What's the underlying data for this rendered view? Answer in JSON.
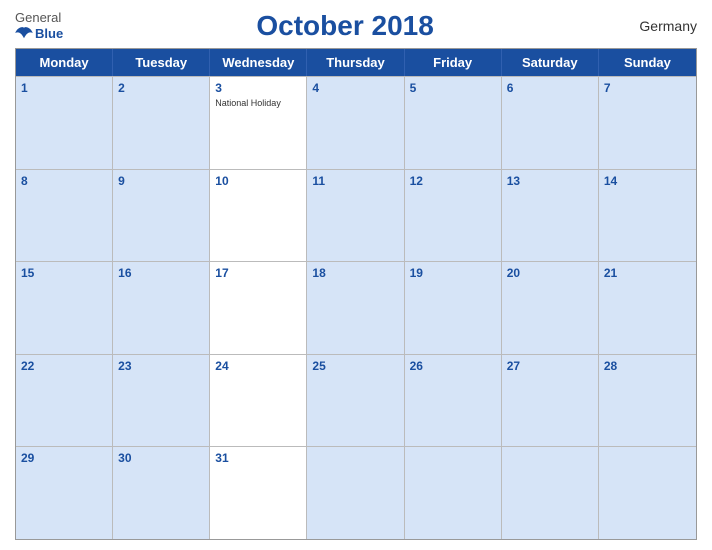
{
  "logo": {
    "general": "General",
    "blue": "Blue"
  },
  "header": {
    "title": "October 2018",
    "country": "Germany"
  },
  "days": [
    "Monday",
    "Tuesday",
    "Wednesday",
    "Thursday",
    "Friday",
    "Saturday",
    "Sunday"
  ],
  "weeks": [
    [
      {
        "num": "1",
        "shaded": true,
        "holiday": ""
      },
      {
        "num": "2",
        "shaded": true,
        "holiday": ""
      },
      {
        "num": "3",
        "shaded": false,
        "holiday": "National Holiday"
      },
      {
        "num": "4",
        "shaded": true,
        "holiday": ""
      },
      {
        "num": "5",
        "shaded": true,
        "holiday": ""
      },
      {
        "num": "6",
        "shaded": true,
        "holiday": ""
      },
      {
        "num": "7",
        "shaded": true,
        "holiday": ""
      }
    ],
    [
      {
        "num": "8",
        "shaded": true,
        "holiday": ""
      },
      {
        "num": "9",
        "shaded": true,
        "holiday": ""
      },
      {
        "num": "10",
        "shaded": false,
        "holiday": ""
      },
      {
        "num": "11",
        "shaded": true,
        "holiday": ""
      },
      {
        "num": "12",
        "shaded": true,
        "holiday": ""
      },
      {
        "num": "13",
        "shaded": true,
        "holiday": ""
      },
      {
        "num": "14",
        "shaded": true,
        "holiday": ""
      }
    ],
    [
      {
        "num": "15",
        "shaded": true,
        "holiday": ""
      },
      {
        "num": "16",
        "shaded": true,
        "holiday": ""
      },
      {
        "num": "17",
        "shaded": false,
        "holiday": ""
      },
      {
        "num": "18",
        "shaded": true,
        "holiday": ""
      },
      {
        "num": "19",
        "shaded": true,
        "holiday": ""
      },
      {
        "num": "20",
        "shaded": true,
        "holiday": ""
      },
      {
        "num": "21",
        "shaded": true,
        "holiday": ""
      }
    ],
    [
      {
        "num": "22",
        "shaded": true,
        "holiday": ""
      },
      {
        "num": "23",
        "shaded": true,
        "holiday": ""
      },
      {
        "num": "24",
        "shaded": false,
        "holiday": ""
      },
      {
        "num": "25",
        "shaded": true,
        "holiday": ""
      },
      {
        "num": "26",
        "shaded": true,
        "holiday": ""
      },
      {
        "num": "27",
        "shaded": true,
        "holiday": ""
      },
      {
        "num": "28",
        "shaded": true,
        "holiday": ""
      }
    ],
    [
      {
        "num": "29",
        "shaded": true,
        "holiday": ""
      },
      {
        "num": "30",
        "shaded": true,
        "holiday": ""
      },
      {
        "num": "31",
        "shaded": false,
        "holiday": ""
      },
      {
        "num": "",
        "shaded": true,
        "holiday": ""
      },
      {
        "num": "",
        "shaded": true,
        "holiday": ""
      },
      {
        "num": "",
        "shaded": true,
        "holiday": ""
      },
      {
        "num": "",
        "shaded": true,
        "holiday": ""
      }
    ]
  ]
}
